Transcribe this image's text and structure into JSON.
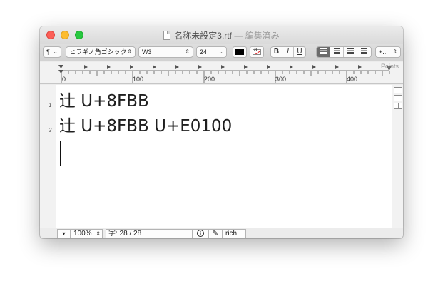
{
  "window": {
    "filename": "名称未設定3.rtf",
    "separator": "—",
    "state": "編集済み"
  },
  "toolbar": {
    "paragraph_style": "¶",
    "font_family": "ヒラギノ角ゴシック",
    "font_weight": "W3",
    "font_size": "24",
    "bold": "B",
    "italic": "I",
    "underline": "U",
    "text_color": "#000000",
    "more": "+..."
  },
  "ruler": {
    "labels": [
      "0",
      "100",
      "200",
      "300",
      "400"
    ],
    "units": "Points"
  },
  "document": {
    "line_numbers": [
      "1",
      "2"
    ],
    "lines": [
      "辻 U+8FBB",
      "辻 U+8FBB U+E0100"
    ]
  },
  "status": {
    "zoom": "100%",
    "char_count": "字: 28 / 28",
    "info": "i",
    "mode": "rich"
  },
  "colors": {
    "close": "#fc5f57",
    "minimize": "#fdbc2e",
    "zoom": "#28c840"
  }
}
